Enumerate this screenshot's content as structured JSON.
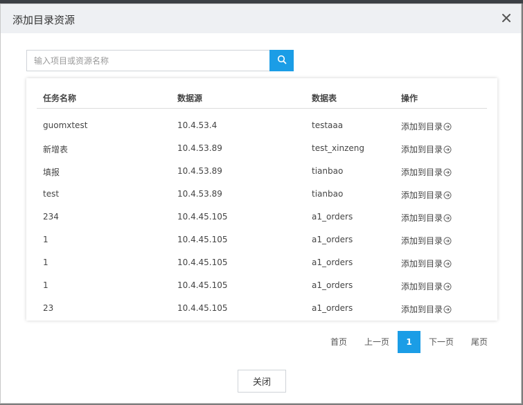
{
  "dialog": {
    "title": "添加目录资源",
    "close_icon": "close-icon"
  },
  "search": {
    "placeholder": "输入项目或资源名称",
    "value": "",
    "button_icon": "search-icon"
  },
  "table": {
    "columns": [
      "任务名称",
      "数据源",
      "数据表",
      "操作"
    ],
    "rows": [
      {
        "name": "guomxtest",
        "source": "10.4.53.4",
        "table": "testaaa",
        "action": "添加到目录"
      },
      {
        "name": "新增表",
        "source": "10.4.53.89",
        "table": "test_xinzeng",
        "action": "添加到目录"
      },
      {
        "name": "填报",
        "source": "10.4.53.89",
        "table": "tianbao",
        "action": "添加到目录"
      },
      {
        "name": "test",
        "source": "10.4.53.89",
        "table": "tianbao",
        "action": "添加到目录"
      },
      {
        "name": "234",
        "source": "10.4.45.105",
        "table": "a1_orders",
        "action": "添加到目录"
      },
      {
        "name": "1",
        "source": "10.4.45.105",
        "table": "a1_orders",
        "action": "添加到目录"
      },
      {
        "name": "1",
        "source": "10.4.45.105",
        "table": "a1_orders",
        "action": "添加到目录"
      },
      {
        "name": "1",
        "source": "10.4.45.105",
        "table": "a1_orders",
        "action": "添加到目录"
      },
      {
        "name": "23",
        "source": "10.4.45.105",
        "table": "a1_orders",
        "action": "添加到目录"
      }
    ]
  },
  "pager": {
    "first": "首页",
    "prev": "上一页",
    "current": "1",
    "next": "下一页",
    "last": "尾页"
  },
  "footer": {
    "close_label": "关闭"
  },
  "colors": {
    "accent": "#1b9de6",
    "header_bg": "#eef0f3"
  }
}
